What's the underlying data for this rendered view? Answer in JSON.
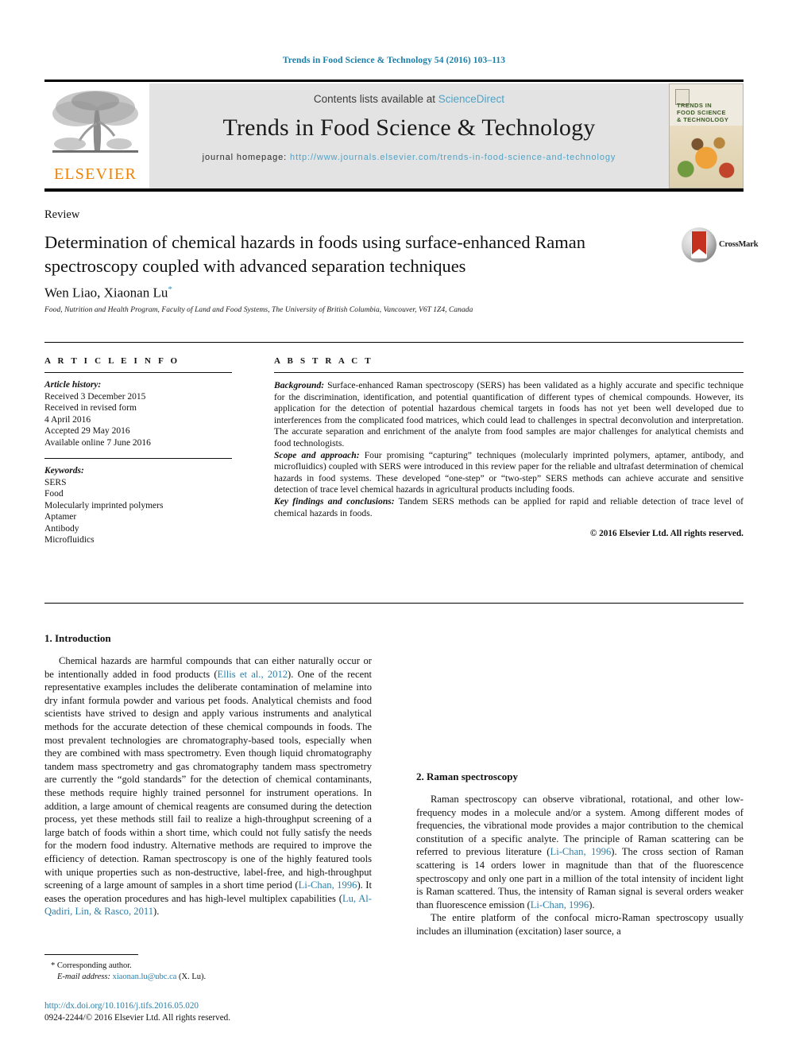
{
  "running_head": "Trends in Food Science & Technology 54 (2016) 103–113",
  "masthead": {
    "contents_prefix": "Contents lists available at",
    "contents_link": "ScienceDirect",
    "journal_title": "Trends in Food Science & Technology",
    "homepage_label": "journal homepage:",
    "homepage_url": "http://www.journals.elsevier.com/trends-in-food-science-and-technology",
    "publisher_name": "ELSEVIER",
    "cover_line1": "TRENDS IN",
    "cover_line2": "FOOD SCIENCE",
    "cover_line3": "& TECHNOLOGY"
  },
  "article": {
    "doctype": "Review",
    "title": "Determination of chemical hazards in foods using surface-enhanced Raman spectroscopy coupled with advanced separation techniques",
    "authors": "Wen Liao, Xiaonan Lu",
    "corresponding_marker": "*",
    "affiliation": "Food, Nutrition and Health Program, Faculty of Land and Food Systems, The University of British Columbia, Vancouver, V6T 1Z4, Canada",
    "crossmark_label": "CrossMark"
  },
  "article_info": {
    "heading": "A R T I C L E  I N F O",
    "history_label": "Article history:",
    "history": [
      "Received 3 December 2015",
      "Received in revised form",
      "4 April 2016",
      "Accepted 29 May 2016",
      "Available online 7 June 2016"
    ],
    "keywords_label": "Keywords:",
    "keywords": [
      "SERS",
      "Food",
      "Molecularly imprinted polymers",
      "Aptamer",
      "Antibody",
      "Microfluidics"
    ]
  },
  "abstract": {
    "heading": "A B S T R A C T",
    "background_label": "Background:",
    "background_text": " Surface-enhanced Raman spectroscopy (SERS) has been validated as a highly accurate and specific technique for the discrimination, identification, and potential quantification of different types of chemical compounds. However, its application for the detection of potential hazardous chemical targets in foods has not yet been well developed due to interferences from the complicated food matrices, which could lead to challenges in spectral deconvolution and interpretation. The accurate separation and enrichment of the analyte from food samples are major challenges for analytical chemists and food technologists.",
    "scope_label": "Scope and approach:",
    "scope_text": " Four promising “capturing” techniques (molecularly imprinted polymers, aptamer, antibody, and microfluidics) coupled with SERS were introduced in this review paper for the reliable and ultrafast determination of chemical hazards in food systems. These developed “one-step” or “two-step” SERS methods can achieve accurate and sensitive detection of trace level chemical hazards in agricultural products including foods.",
    "findings_label": "Key findings and conclusions:",
    "findings_text": " Tandem SERS methods can be applied for rapid and reliable detection of trace level of chemical hazards in foods.",
    "copyright": "© 2016 Elsevier Ltd. All rights reserved."
  },
  "body": {
    "section1_heading": "1. Introduction",
    "section2_heading": "2. Raman spectroscopy",
    "p1_a": "Chemical hazards are harmful compounds that can either naturally occur or be intentionally added in food products (",
    "p1_cite1": "Ellis et al., 2012",
    "p1_b": "). One of the recent representative examples includes the deliberate contamination of melamine into dry infant formula powder and various pet foods. Analytical chemists and food scientists have strived to design and apply various instruments and analytical methods for the accurate detection of these chemical compounds in foods. The most prevalent technologies are chromatography-based tools, especially when they are combined with mass spectrometry. Even though liquid chromatography tandem mass spectrometry and gas chromatography tandem mass spectrometry are currently the “gold standards” for the detection of chemical contaminants, these methods require highly trained personnel for instrument operations. In addition, a large amount of chemical reagents are consumed during the detection process, yet these methods still fail to realize a high-throughput screening of a large batch of foods within a short time, which could not fully satisfy the needs for the modern food industry. Alternative methods are required to improve the efficiency of detection. Raman spectroscopy is one of the highly featured tools with unique properties such as non-destructive, label-free, and high-throughput screening of a large amount of samples in a short time period (",
    "p1_cite2": "Li-Chan, 1996",
    "p1_c": "). It eases the operation procedures and has high-level multiplex capabilities (",
    "p1_cite3": "Lu, Al-Qadiri, Lin, & Rasco, 2011",
    "p1_d": ").",
    "p2_a": "Raman spectroscopy can observe vibrational, rotational, and other low-frequency modes in a molecule and/or a system. Among different modes of frequencies, the vibrational mode provides a major contribution to the chemical constitution of a specific analyte. The principle of Raman scattering can be referred to previous literature (",
    "p2_cite1": "Li-Chan, 1996",
    "p2_b": "). The cross section of Raman scattering is 14 orders lower in magnitude than that of the fluorescence spectroscopy and only one part in a million of the total intensity of incident light is Raman scattered. Thus, the intensity of Raman signal is several orders weaker than fluorescence emission (",
    "p2_cite2": "Li-Chan, 1996",
    "p2_c": ").",
    "p3": "The entire platform of the confocal micro-Raman spectroscopy usually includes an illumination (excitation) laser source, a"
  },
  "footer": {
    "corresponding_marker": "*",
    "corresponding_label": "Corresponding author.",
    "email_label": "E-mail address:",
    "email": "xiaonan.lu@ubc.ca",
    "email_suffix": " (X. Lu).",
    "doi": "http://dx.doi.org/10.1016/j.tifs.2016.05.020",
    "issn_line": "0924-2244/© 2016 Elsevier Ltd. All rights reserved."
  },
  "colors": {
    "link": "#2c7ea8",
    "running_head": "#1a7fa8",
    "elsevier_orange": "#ef8200",
    "band_gray": "#e3e3e3"
  }
}
